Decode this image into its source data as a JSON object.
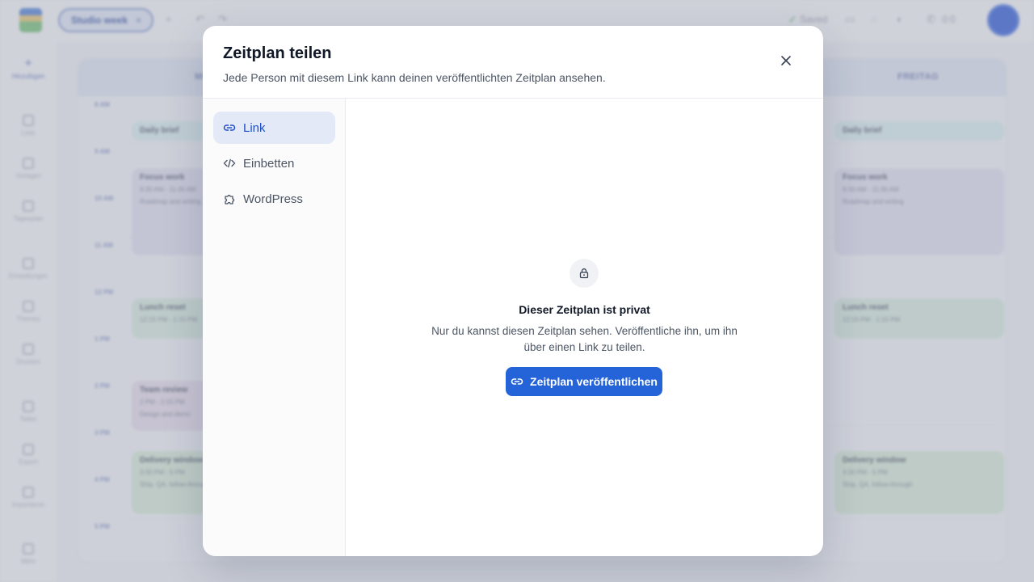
{
  "app": {
    "project_pill": "Studio week",
    "saved_label": "Saved",
    "call_label": "0:0",
    "sidebar": [
      {
        "label": "Hinzufügen",
        "icon": "plus-icon"
      },
      {
        "label": "Liste",
        "icon": "list-icon"
      },
      {
        "label": "Vorlagen",
        "icon": "template-icon"
      },
      {
        "label": "Tagesplan",
        "icon": "calendar-icon"
      },
      {
        "label": "Einstellungen",
        "icon": "settings-icon"
      },
      {
        "label": "Themes",
        "icon": "palette-icon"
      },
      {
        "label": "Drucken",
        "icon": "print-icon"
      },
      {
        "label": "Teilen",
        "icon": "share-icon"
      },
      {
        "label": "Export",
        "icon": "export-icon"
      },
      {
        "label": "Importieren",
        "icon": "import-icon"
      },
      {
        "label": "Mehr",
        "icon": "more-icon"
      }
    ],
    "calendar": {
      "days": [
        "MO",
        "FREITAG"
      ],
      "times": [
        "8 AM",
        "9 AM",
        "10 AM",
        "11 AM",
        "12 PM",
        "1 PM",
        "2 PM",
        "3 PM",
        "4 PM",
        "5 PM"
      ],
      "events_left": [
        {
          "title": "Daily brief",
          "time": "",
          "note": ""
        },
        {
          "title": "Focus work",
          "time": "9:30 AM - 11:30 AM",
          "note": "Roadmap and writing"
        },
        {
          "title": "Lunch reset",
          "time": "12:15 PM - 1:15 PM",
          "note": ""
        },
        {
          "title": "Team review",
          "time": "2 PM - 2:15 PM",
          "note": "Design and demo"
        },
        {
          "title": "Delivery window",
          "time": "3:30 PM - 5 PM",
          "note": "Ship, QA, follow-through"
        }
      ],
      "events_right": [
        {
          "title": "Daily brief",
          "time": "",
          "note": ""
        },
        {
          "title": "Focus work",
          "time": "9:30 AM - 11:30 AM",
          "note": "Roadmap and writing"
        },
        {
          "title": "Lunch reset",
          "time": "12:15 PM - 1:15 PM",
          "note": ""
        },
        {
          "title": "Delivery window",
          "time": "3:30 PM - 5 PM",
          "note": "Ship, QA, follow-through"
        }
      ]
    }
  },
  "modal": {
    "title": "Zeitplan teilen",
    "subtitle": "Jede Person mit diesem Link kann deinen veröffentlichten Zeitplan ansehen.",
    "close_icon": "close-icon",
    "nav": [
      {
        "label": "Link",
        "icon": "link-icon",
        "active": true
      },
      {
        "label": "Einbetten",
        "icon": "code-icon",
        "active": false
      },
      {
        "label": "WordPress",
        "icon": "puzzle-icon",
        "active": false
      }
    ],
    "body": {
      "lock_icon": "lock-icon",
      "heading": "Dieser Zeitplan ist privat",
      "description": "Nur du kannst diesen Zeitplan sehen. Veröffentliche ihn, um ihn über einen Link zu teilen.",
      "publish_button": "Zeitplan veröffentlichen"
    },
    "colors": {
      "accent": "#2563d9",
      "active_nav_bg": "#e4e9f8",
      "active_nav_text": "#1f4fc8"
    }
  }
}
